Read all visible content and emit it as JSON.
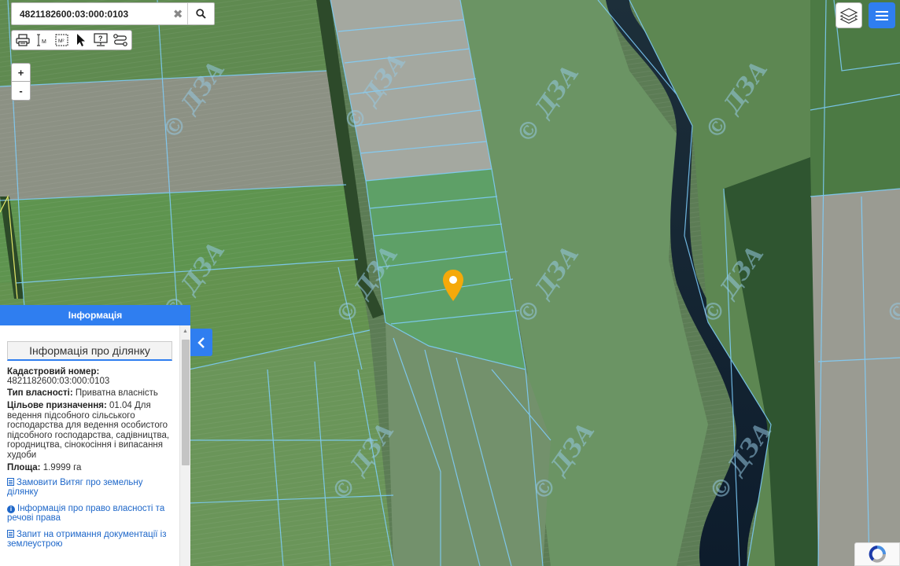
{
  "search": {
    "value": "4821182600:03:000:0103",
    "clear_icon": "close-icon",
    "search_icon": "search-icon"
  },
  "toolbar": {
    "tools": [
      "print-icon",
      "ruler-icon",
      "area-icon",
      "pointer-icon",
      "identify-icon",
      "route-icon"
    ],
    "ruler_label": "M",
    "area_label": "M²"
  },
  "zoom": {
    "in_label": "+",
    "out_label": "-"
  },
  "map": {
    "watermark": "© ДЗА",
    "marker_color": "#f5a90a",
    "parcel_outline_color": "#7fd0ff"
  },
  "info_panel": {
    "header": "Інформація",
    "section_title": "Інформація про ділянку",
    "cadastral_label": "Кадастровий номер:",
    "cadastral_value": "4821182600:03:000:0103",
    "ownership_label": "Тип власності:",
    "ownership_value": "Приватна власність",
    "purpose_label": "Цільове призначення:",
    "purpose_value": "01.04 Для ведення підсобного сільського господарства для ведення особистого підсобного господарства, садівництва, городництва, сінокосіння і випасання худоби",
    "area_label": "Площа:",
    "area_value": "1.9999 га",
    "links": [
      "Замовити Витяг про земельну ділянку",
      "Інформація про право власності та речові права",
      "Запит на отримання документації із землеустрою"
    ]
  },
  "colors": {
    "accent": "#2f7ef0",
    "link": "#1e67c9"
  }
}
